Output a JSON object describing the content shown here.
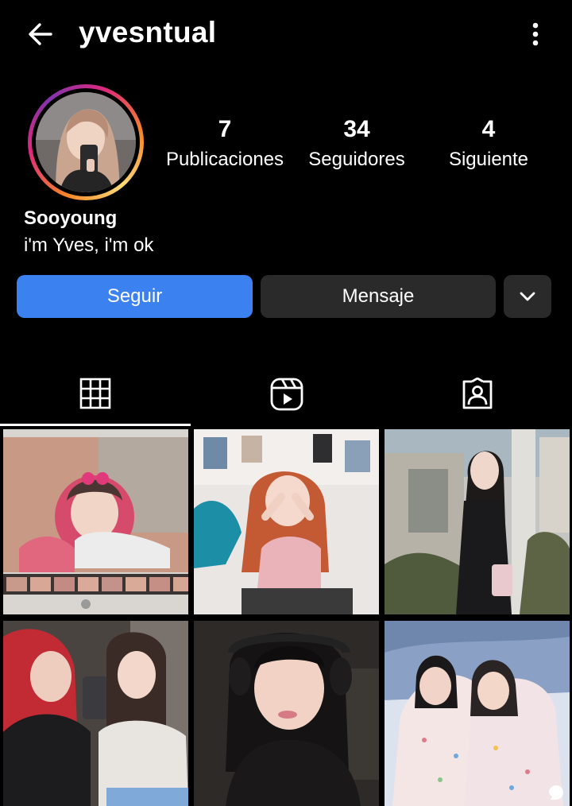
{
  "header": {
    "username": "yvesntual",
    "back_icon": "arrow-left-icon",
    "menu_icon": "more-vertical-icon"
  },
  "profile": {
    "display_name": "Sooyoung",
    "bio": "i'm Yves, i'm ok",
    "stats": [
      {
        "value": "7",
        "label": "Publicaciones"
      },
      {
        "value": "34",
        "label": "Seguidores"
      },
      {
        "value": "4",
        "label": "Siguiente"
      }
    ]
  },
  "actions": {
    "follow_label": "Seguir",
    "message_label": "Mensaje",
    "suggest_icon": "chevron-down-icon"
  },
  "tabs": [
    {
      "icon": "grid-icon",
      "active": true
    },
    {
      "icon": "reels-icon",
      "active": false
    },
    {
      "icon": "tagged-icon",
      "active": false
    }
  ],
  "posts": [
    {
      "index": 1,
      "description": "photo booth selfie"
    },
    {
      "index": 2,
      "description": "girl with orange hair"
    },
    {
      "index": 3,
      "description": "girl by building"
    },
    {
      "index": 4,
      "description": "mirror selfie duo"
    },
    {
      "index": 5,
      "description": "headphones portrait"
    },
    {
      "index": 6,
      "description": "hugging on bed",
      "reel": true
    }
  ],
  "colors": {
    "accent": "#3b82f0",
    "button_dark": "#2a2a2a",
    "background": "#000000"
  }
}
